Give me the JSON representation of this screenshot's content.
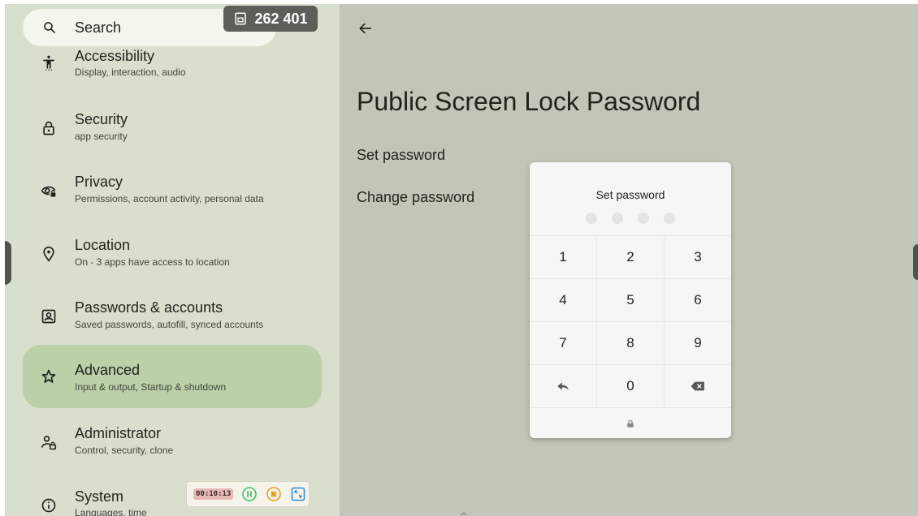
{
  "search": {
    "label": "Search",
    "icon": "search-icon"
  },
  "screen_badge": {
    "value": "262 401",
    "icon": "screen-share-icon"
  },
  "sidebar": {
    "items": [
      {
        "title": "Accessibility",
        "subtitle": "Display, interaction, audio",
        "icon": "accessibility-icon"
      },
      {
        "title": "Security",
        "subtitle": "app security",
        "icon": "lock-icon"
      },
      {
        "title": "Privacy",
        "subtitle": "Permissions, account activity, personal data",
        "icon": "privacy-eye-icon"
      },
      {
        "title": "Location",
        "subtitle": "On - 3 apps have access to location",
        "icon": "location-pin-icon"
      },
      {
        "title": "Passwords & accounts",
        "subtitle": "Saved passwords, autofill, synced accounts",
        "icon": "account-box-icon"
      },
      {
        "title": "Advanced",
        "subtitle": "Input & output, Startup & shutdown",
        "icon": "star-outline-icon"
      },
      {
        "title": "Administrator",
        "subtitle": "Control, security, clone",
        "icon": "admin-icon"
      },
      {
        "title": "System",
        "subtitle": "Languages, time",
        "icon": "info-icon"
      }
    ]
  },
  "recorder": {
    "time": "00:10:13"
  },
  "main": {
    "title": "Public Screen Lock Password",
    "options": [
      "Set password",
      "Change password"
    ]
  },
  "dialog": {
    "title": "Set password",
    "keys": [
      [
        "1",
        "2",
        "3"
      ],
      [
        "4",
        "5",
        "6"
      ],
      [
        "7",
        "8",
        "9"
      ],
      [
        "",
        "0",
        ""
      ]
    ]
  },
  "colors": {
    "sidebar_bg": "#d9dfcd",
    "main_bg": "#c2c6b8",
    "active_item": "#bccfa8",
    "search_bg": "#f3f6ec"
  }
}
